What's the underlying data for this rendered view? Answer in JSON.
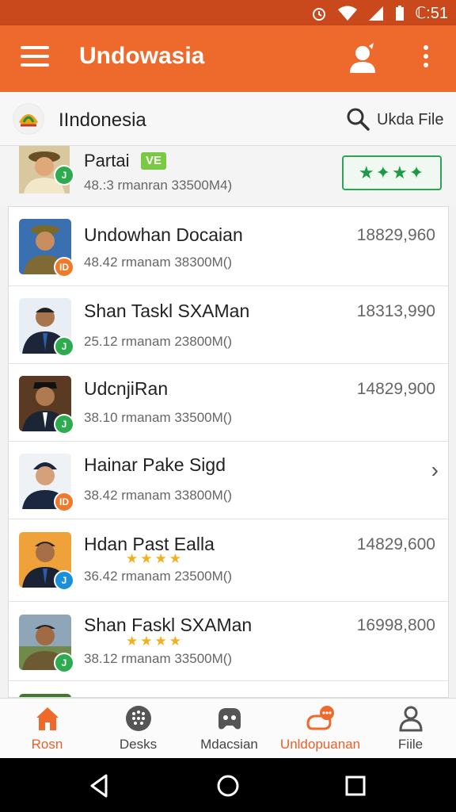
{
  "status_bar": {
    "time": "ℂ:51"
  },
  "app_bar": {
    "title": "Undowasia"
  },
  "search_strip": {
    "country": "IIndonesia",
    "search_label": "Ukda File"
  },
  "top_item": {
    "name": "Partai",
    "badge": "VE",
    "meta": "48.:3 rmanran 33500M4)",
    "rating": "★✦★✦"
  },
  "rows": [
    {
      "name": "Undowhan Docaian",
      "meta": "48.42 rmanam 38300M()",
      "value": "18829,960",
      "badge": "ID",
      "badge_color": "orange"
    },
    {
      "name": "Shan Taskl SXAMan",
      "meta": "25.12 rmanam 23800M()",
      "value": "18313,990",
      "badge": "J",
      "badge_color": "green"
    },
    {
      "name": "UdcnjiRan",
      "meta": "38.10 rmanam 33500M()",
      "value": "14829,900",
      "badge": "J",
      "badge_color": "green"
    },
    {
      "name": "Hainar Pake Sigd",
      "meta": "38.42 rmanam 33800M()",
      "value": "",
      "badge": "ID",
      "badge_color": "orange"
    },
    {
      "name": "Hdan Past Ealla",
      "meta": "36.42 rmanam 23500M()",
      "value": "14829,600",
      "stars": "★★★★",
      "badge": "J",
      "badge_color": "blue"
    },
    {
      "name": "Shan Faskl SXAMan",
      "meta": "38.12 rmanam 33500M()",
      "value": "16998,800",
      "stars": "★★★★",
      "badge": "J",
      "badge_color": "green"
    },
    {
      "name": "",
      "meta": "",
      "value": ""
    }
  ],
  "bottom_nav": [
    {
      "label": "Rosn",
      "icon": "home-icon",
      "active": true
    },
    {
      "label": "Desks",
      "icon": "dots-disc-icon"
    },
    {
      "label": "Mdacsian",
      "icon": "gamepad-icon"
    },
    {
      "label": "Unldopuanan",
      "icon": "chat-bubble-icon",
      "active": true
    },
    {
      "label": "Fiile",
      "icon": "person-icon"
    }
  ],
  "colors": {
    "accent": "#ee6a2c",
    "status_bar": "#c9491c",
    "green": "#2cab4f"
  }
}
